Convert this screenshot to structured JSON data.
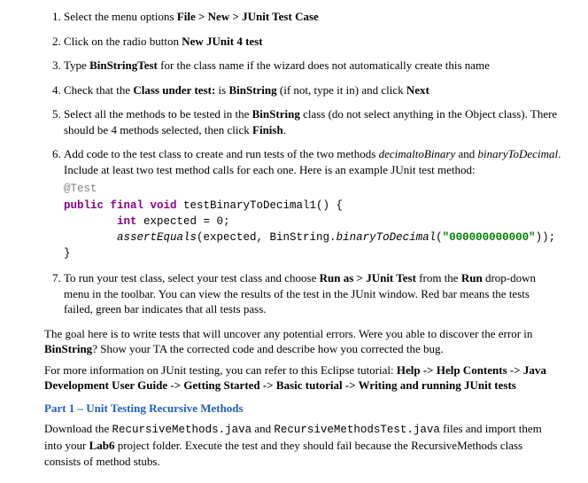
{
  "steps": {
    "s1_pre": "Select the menu options ",
    "s1_bold": "File > New > JUnit Test Case",
    "s2_pre": "Click on the radio button ",
    "s2_bold": "New JUnit 4 test",
    "s3_pre": "Type ",
    "s3_bold": "BinStringTest",
    "s3_post": " for the class name if the wizard does not automatically create this name",
    "s4_pre": "Check that the ",
    "s4_b1": "Class under test:",
    "s4_mid": " is ",
    "s4_b2": "BinString",
    "s4_post": " (if not, type it in) and click ",
    "s4_b3": "Next",
    "s5_pre": "Select all the methods to be tested in the ",
    "s5_b1": "BinString",
    "s5_mid": " class (do not select anything in the Object class). There should be 4 methods selected, then click ",
    "s5_b2": "Finish",
    "s5_post": ".",
    "s6_pre": "Add code to the test class to create and run tests of the two methods ",
    "s6_i1": "decimaltoBinary",
    "s6_mid": " and ",
    "s6_i2": "binaryToDecimal",
    "s6_post": ".  Include at least two test method calls for each one. Here is an example JUnit test method:",
    "s7_pre": "To run your test class, select your test class and choose ",
    "s7_b1": "Run as > JUnit Test",
    "s7_mid1": " from the ",
    "s7_b2": "Run",
    "s7_post": " drop-down menu in the toolbar.  You can view the results of the test in the JUnit window.  Red bar means the tests failed, green bar indicates that all tests pass."
  },
  "code": {
    "annot": "@Test",
    "kw1": "public final void",
    "fname": " testBinaryToDecimal1() {",
    "indent2": "        ",
    "kw2": "int",
    "expdecl": " expected = ",
    "zero": "0",
    "semi": ";",
    "assertcall_a": "assertEquals",
    "assertcall_b": "(expected, BinString.",
    "btod": "binaryToDecimal",
    "open2": "(",
    "strlit": "\"000000000000\"",
    "close": "));",
    "brace": "}"
  },
  "para1_a": "The goal here is to write tests that will uncover any potential errors. Were you able to discover the error in ",
  "para1_b": "BinString",
  "para1_c": "? Show your TA the corrected code and describe how you corrected the bug.",
  "para2_a": "For more information on JUnit testing, you can refer to this Eclipse tutorial: ",
  "para2_b": "Help -> Help Contents -> Java Development User Guide -> Getting Started -> Basic tutorial -> Writing and running JUnit tests",
  "part_heading": "Part 1 – Unit Testing Recursive Methods",
  "dl_a": "Download the ",
  "dl_f1": "RecursiveMethods.java",
  "dl_mid": " and ",
  "dl_f2": "RecursiveMethodsTest.java",
  "dl_b": " files and import them into your ",
  "dl_bold": "Lab6",
  "dl_c": " project folder. Execute the test and they should fail because the RecursiveMethods class consists of method stubs."
}
